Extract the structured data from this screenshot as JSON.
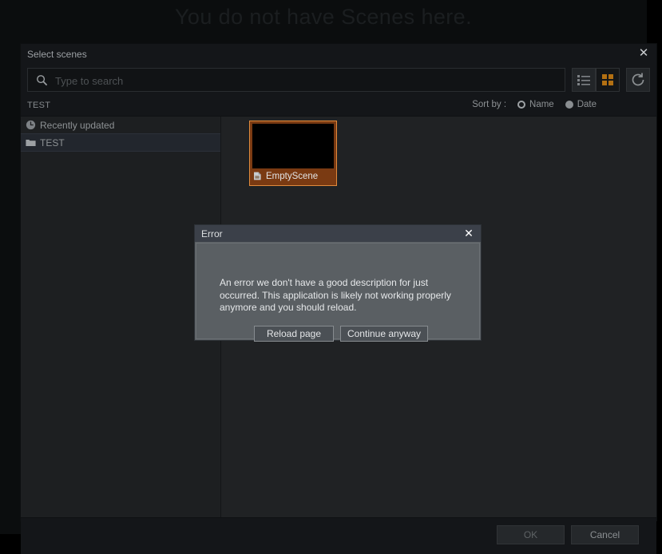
{
  "background": {
    "heading": "You do not have Scenes here."
  },
  "modal": {
    "title": "Select scenes",
    "close_label": "✕",
    "search": {
      "placeholder": "Type to search",
      "value": "",
      "icon": "search-icon"
    },
    "view_toggle": {
      "list_icon": "list-view-icon",
      "grid_icon": "grid-view-icon",
      "active": "grid",
      "grid_color": "#b37012"
    },
    "refresh": {
      "icon": "refresh-icon"
    },
    "breadcrumb": "TEST",
    "sort": {
      "label": "Sort by :",
      "options": [
        {
          "label": "Name",
          "style": "ring"
        },
        {
          "label": "Date",
          "style": "dot"
        }
      ]
    },
    "folders": [
      {
        "label": "Recently updated",
        "icon": "clock-icon",
        "selected": false
      },
      {
        "label": "TEST",
        "icon": "folder-icon",
        "selected": true
      }
    ],
    "scenes": [
      {
        "label": "EmptyScene",
        "icon": "scene-file-icon",
        "selected": true,
        "accent": "#e08a3c"
      }
    ],
    "footer": {
      "ok_label": "OK",
      "cancel_label": "Cancel"
    }
  },
  "error_dialog": {
    "title": "Error",
    "close_label": "✕",
    "message": "An error we don't have a good description for just occurred. This application is likely not working properly anymore and you should reload.",
    "buttons": {
      "reload_label": "Reload page",
      "continue_label": "Continue anyway"
    }
  }
}
